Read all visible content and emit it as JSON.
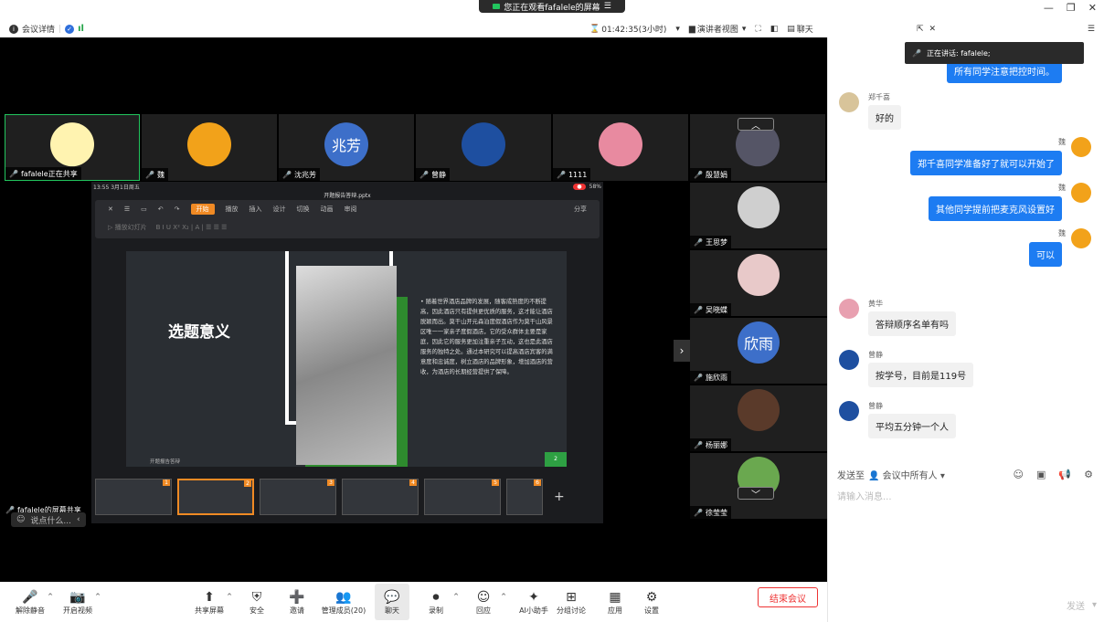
{
  "share_banner": {
    "text": "您正在观看fafalele的屏幕",
    "menu_icon": "menu-icon"
  },
  "window": {
    "minimize": "—",
    "restore": "❐",
    "close": "✕"
  },
  "topbar": {
    "meeting_info": "会议详情",
    "timer": "01:42:35(3小时)",
    "view_label": "演讲者视图",
    "chat_label": "聊天"
  },
  "video_tiles": [
    {
      "name": "fafalele正在共享",
      "avatar_text": "",
      "avatar_color": "#fff3b0",
      "mic": "green"
    },
    {
      "name": "魏",
      "avatar_text": "",
      "avatar_color": "#f2a21a",
      "mic": "red"
    },
    {
      "name": "沈兆芳",
      "avatar_text": "兆芳",
      "avatar_color": "#3d6fc9",
      "mic": "red"
    },
    {
      "name": "曾静",
      "avatar_text": "",
      "avatar_color": "#1e4fa0",
      "mic": "red"
    },
    {
      "name": "1111",
      "avatar_text": "",
      "avatar_color": "#e88aa0",
      "mic": "red"
    },
    {
      "name": "殷慧娟",
      "avatar_text": "",
      "avatar_color": "#556",
      "mic": "red"
    }
  ],
  "side_tiles": [
    {
      "name": "王思梦",
      "avatar_text": "",
      "avatar_color": "#cfcfcf"
    },
    {
      "name": "吴晓蝶",
      "avatar_text": "",
      "avatar_color": "#e8c9c9"
    },
    {
      "name": "施欣雨",
      "avatar_text": "欣雨",
      "avatar_color": "#3d6fc9"
    },
    {
      "name": "杨丽娜",
      "avatar_text": "",
      "avatar_color": "#5a3a2a"
    },
    {
      "name": "徐莹莹",
      "avatar_text": "",
      "avatar_color": "#6aa84f"
    }
  ],
  "shared_screen": {
    "status_time": "13:55  3月1日周五",
    "status_right": "58%",
    "file_name": "开题报告答辩.pptx",
    "tabs": [
      "开始",
      "播放",
      "插入",
      "设计",
      "切换",
      "动画",
      "审阅"
    ],
    "active_tab": "开始",
    "share_label": "分享",
    "play_label": "播放幻灯片",
    "slide_title": "选题意义",
    "slide_text": "随着世界酒店品牌的发展，随客成熟度的不断提高，因此酒店只有提供更优质的服务，这才能让酒店脱颖而出。莫干山开元森泊度假酒店作为莫干山风景区唯一一家亲子度假酒店，它的受众群体主要是家庭，因此它的服务更加注重亲子互动，这也是此酒店服务的独特之处。通过本研究可以提高酒店宾客的满意度和忠诚度，树立酒店的品牌形象，增加酒店的营收，为酒店的长期经营提供了保障。",
    "slide_footer": "开题报告答辩",
    "slide_page": "2",
    "thumb_numbers": [
      "1",
      "2",
      "3",
      "4",
      "5",
      "6"
    ]
  },
  "overlay": {
    "sharer": "fafalele的屏幕共享",
    "say_something": "说点什么..."
  },
  "bottom_toolbar": [
    {
      "label": "解除静音",
      "icon": "mic-off-icon",
      "glyph": "🎤",
      "caret": true
    },
    {
      "label": "开启视频",
      "icon": "video-off-icon",
      "glyph": "📷",
      "caret": true
    },
    {
      "label": "共享屏幕",
      "icon": "share-screen-icon",
      "glyph": "⬆",
      "caret": true
    },
    {
      "label": "安全",
      "icon": "shield-icon",
      "glyph": "⛨",
      "caret": false
    },
    {
      "label": "邀请",
      "icon": "invite-icon",
      "glyph": "➕",
      "caret": false
    },
    {
      "label": "管理成员(20)",
      "icon": "members-icon",
      "glyph": "👥",
      "caret": false
    },
    {
      "label": "聊天",
      "icon": "chat-icon",
      "glyph": "💬",
      "caret": false
    },
    {
      "label": "录制",
      "icon": "record-icon",
      "glyph": "⏺",
      "caret": true
    },
    {
      "label": "回应",
      "icon": "reaction-icon",
      "glyph": "☺",
      "caret": true
    },
    {
      "label": "AI小助手",
      "icon": "ai-assistant-icon",
      "glyph": "✦",
      "caret": false
    },
    {
      "label": "分组讨论",
      "icon": "breakout-icon",
      "glyph": "⊞",
      "caret": false
    },
    {
      "label": "应用",
      "icon": "apps-icon",
      "glyph": "▦",
      "caret": false
    },
    {
      "label": "设置",
      "icon": "settings-icon",
      "glyph": "⚙",
      "caret": false
    }
  ],
  "end_meeting": "结束会议",
  "chat": {
    "speaking": "正在讲话:  fafalele;",
    "messages": [
      {
        "from": "me",
        "name": "",
        "text": "所有同学注意把控时间。"
      },
      {
        "from": "other",
        "name": "郑千喜",
        "text": "好的",
        "avatar_color": "#d8c49a"
      },
      {
        "from": "me",
        "name": "魏",
        "text": "郑千喜同学准备好了就可以开始了"
      },
      {
        "from": "me",
        "name": "魏",
        "text": "其他同学提前把麦克风设置好"
      },
      {
        "from": "me",
        "name": "魏",
        "text": "可以"
      },
      {
        "from": "other",
        "name": "黄华",
        "text": "答辩顺序名单有吗",
        "avatar_color": "#e8a0b0"
      },
      {
        "from": "other",
        "name": "曾静",
        "text": "按学号，目前是119号",
        "avatar_color": "#1e4fa0"
      },
      {
        "from": "other",
        "name": "曾静",
        "text": "平均五分钟一个人",
        "avatar_color": "#1e4fa0"
      }
    ],
    "send_to": "发送至",
    "recipient": "会议中所有人",
    "input_placeholder": "请输入消息...",
    "send_label": "发送"
  }
}
